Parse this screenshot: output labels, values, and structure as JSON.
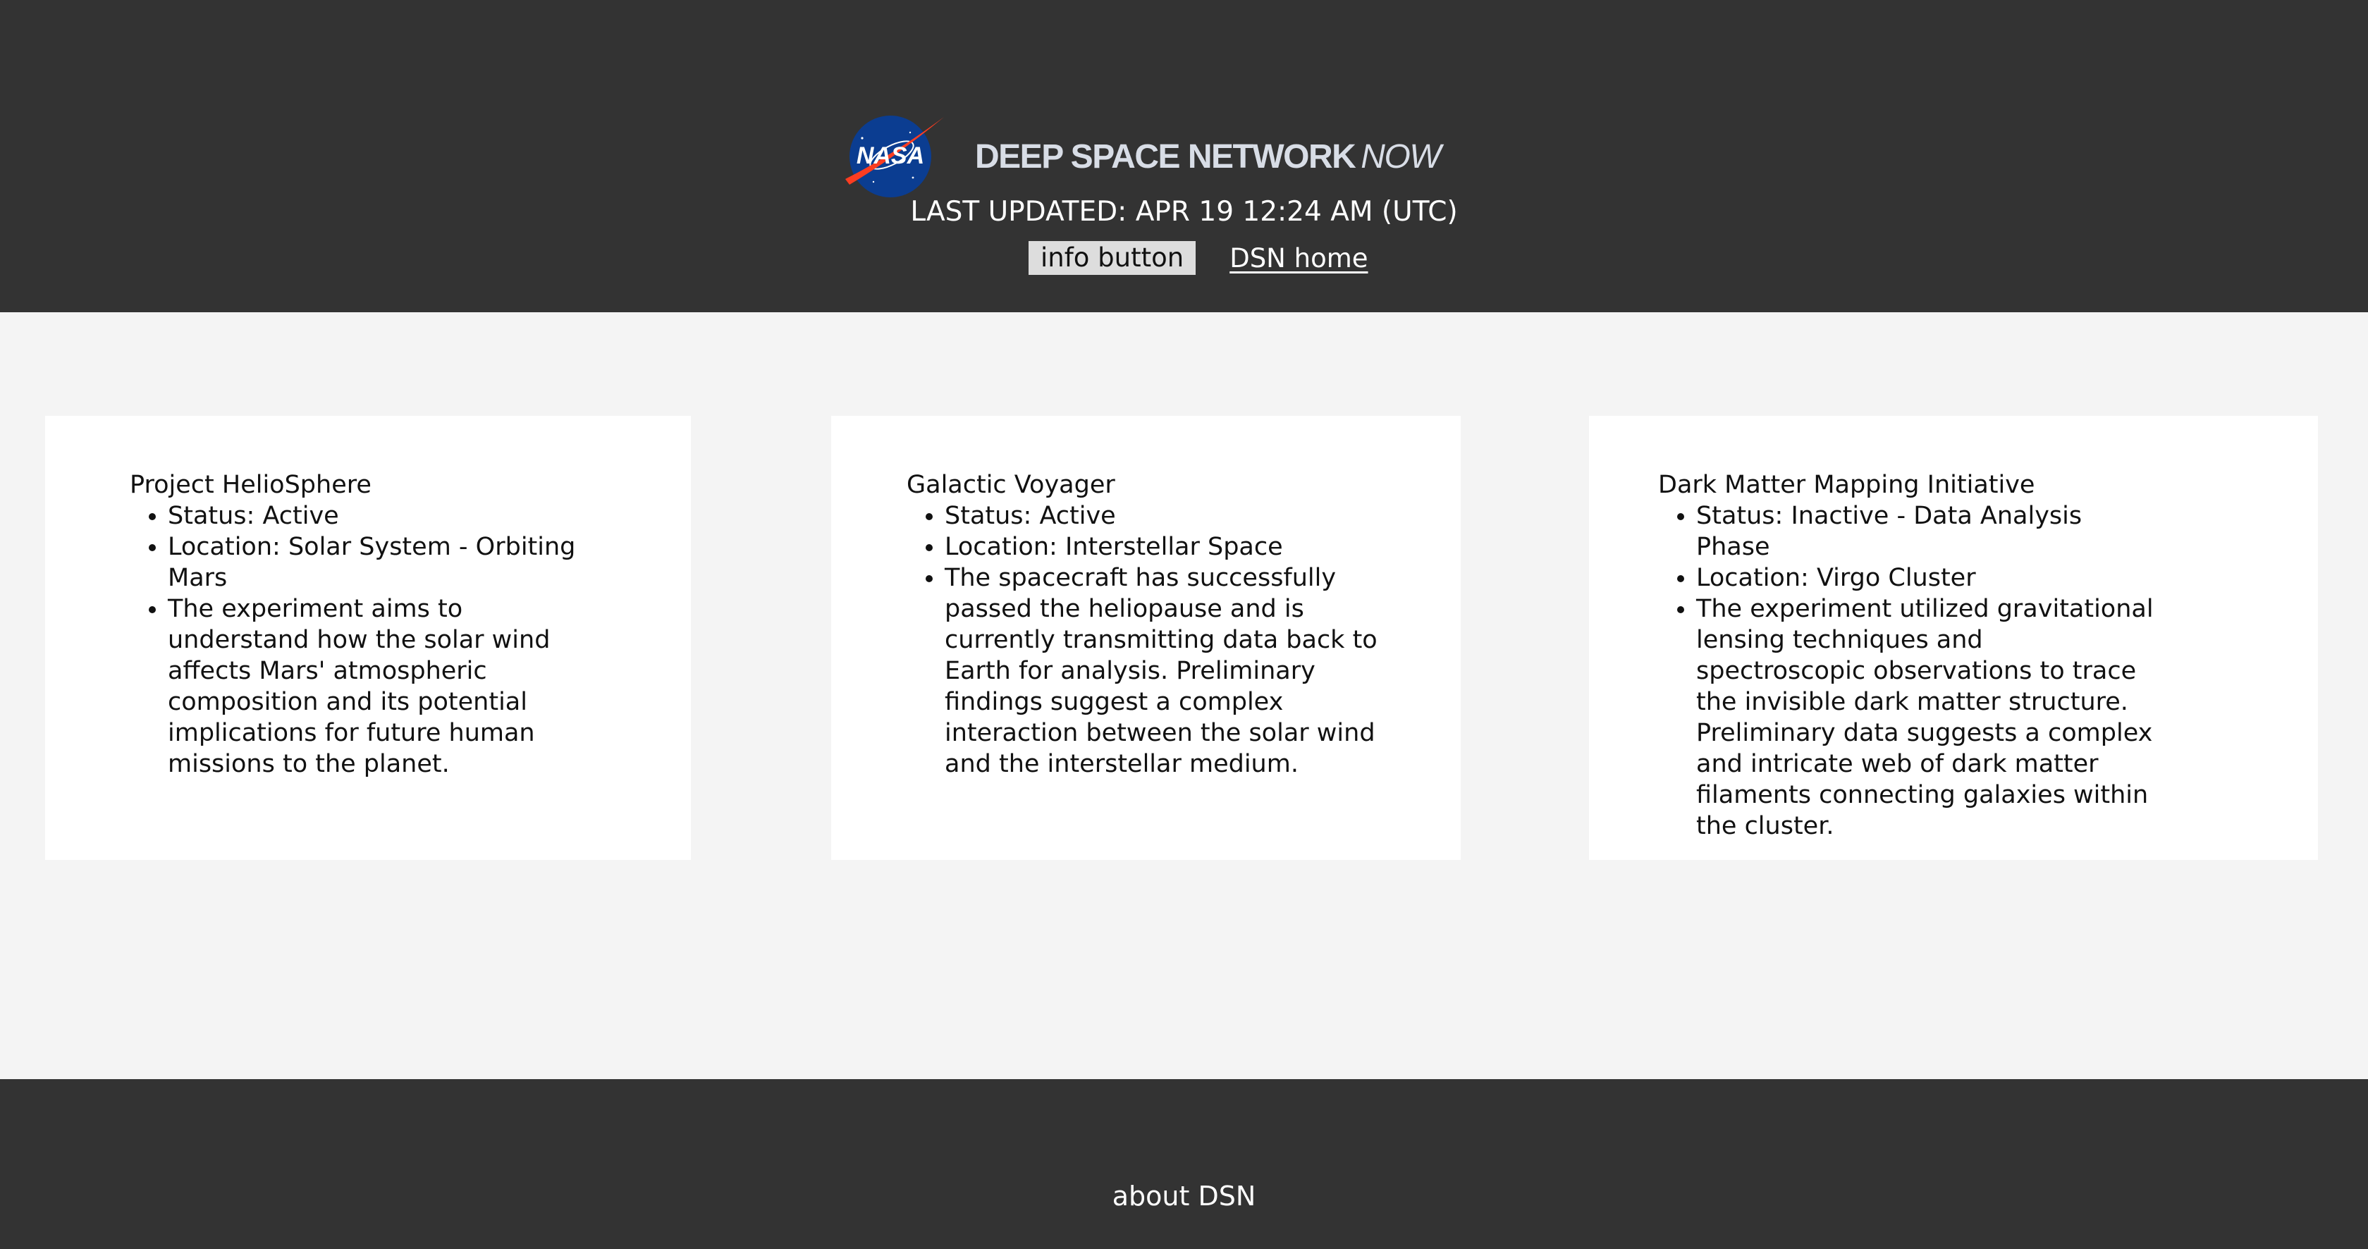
{
  "header": {
    "logo_text": "NASA",
    "title_main": "DEEP SPACE NETWORK",
    "title_suffix": "NOW",
    "last_updated": "LAST UPDATED: APR 19 12:24 AM (UTC)",
    "info_button_label": "info button",
    "home_link_label": "DSN home"
  },
  "cards": [
    {
      "title": "Project HelioSphere",
      "status": "Status: Active",
      "location": "Location: Solar System - Orbiting Mars",
      "description": "The experiment aims to understand how the solar wind affects Mars' atmospheric composition and its potential implications for future human missions to the planet."
    },
    {
      "title": "Galactic Voyager",
      "status": "Status: Active",
      "location": "Location: Interstellar Space",
      "description": "The spacecraft has successfully passed the heliopause and is currently transmitting data back to Earth for analysis. Preliminary findings suggest a complex interaction between the solar wind and the interstellar medium."
    },
    {
      "title": "Dark Matter Mapping Initiative",
      "status": "Status: Inactive - Data Analysis Phase",
      "location": "Location: Virgo Cluster",
      "description": "The experiment utilized gravitational lensing techniques and spectroscopic observations to trace the invisible dark matter structure. Preliminary data suggests a complex and intricate web of dark matter filaments connecting galaxies within the cluster."
    }
  ],
  "footer": {
    "about_link_label": "about DSN"
  },
  "colors": {
    "header_bg": "#333333",
    "page_bg": "#f4f4f4",
    "card_bg": "#ffffff",
    "nasa_blue": "#0b3d91",
    "nasa_red": "#fc3d21"
  }
}
